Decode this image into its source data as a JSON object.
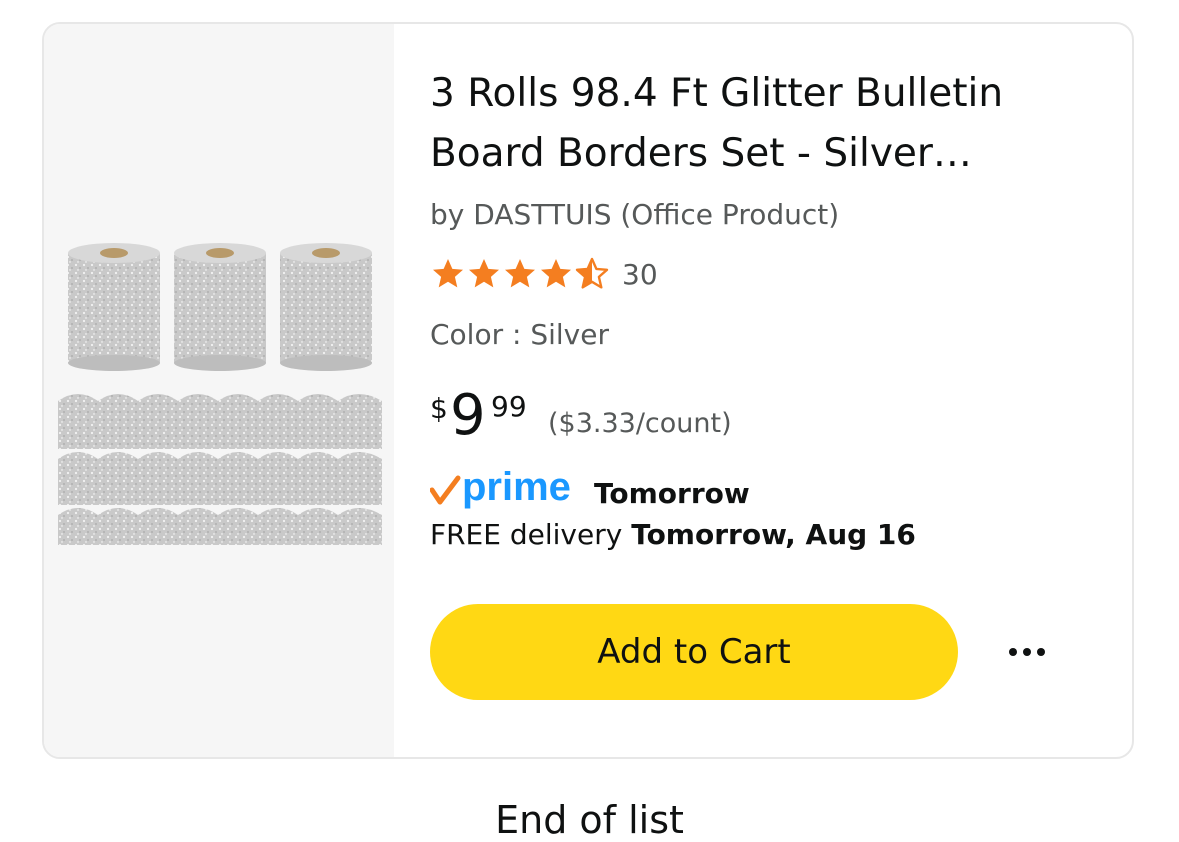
{
  "product": {
    "title": "3 Rolls 98.4 Ft Glitter Bulletin Board Borders Set - Silver…",
    "byline": "by DASTTUIS (Office Product)",
    "rating": {
      "stars": 4.5,
      "count": "30"
    },
    "color_line": "Color : Silver",
    "price": {
      "symbol": "$",
      "whole": "9",
      "fraction": "99",
      "unit_price": "($3.33/count)"
    },
    "prime": {
      "logo": "prime",
      "day": "Tomorrow"
    },
    "delivery": {
      "prefix": "FREE delivery",
      "date": "Tomorrow, Aug 16"
    },
    "image": "glitter-border-rolls-image"
  },
  "actions": {
    "add_to_cart": "Add to Cart",
    "more_icon": "more-options-icon"
  },
  "footer": {
    "end_of_list": "End of list"
  },
  "colors": {
    "cart_button": "#ffd814",
    "star": "#f47e20",
    "prime_blue": "#1a98ff",
    "prime_check": "#f47e20"
  }
}
